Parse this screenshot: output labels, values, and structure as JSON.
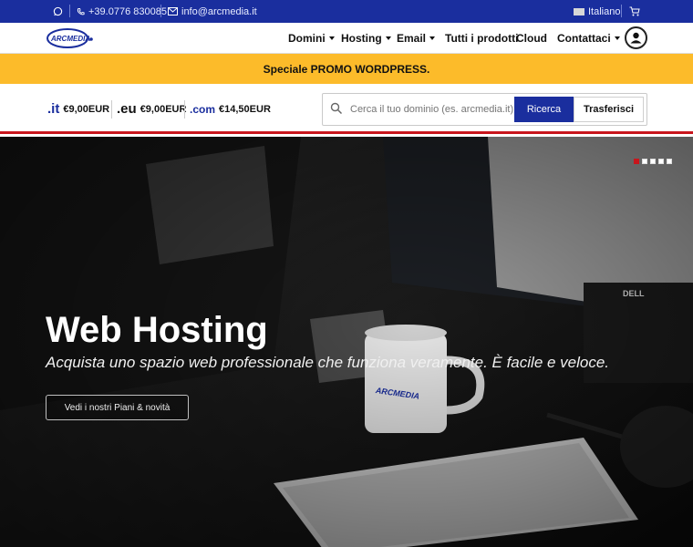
{
  "topbar": {
    "phone": "+39.0776 830085",
    "email": "info@arcmedia.it",
    "language": "Italiano",
    "icons": [
      "whatsapp-icon",
      "phone-icon",
      "mail-icon",
      "flag-icon",
      "cart-icon"
    ]
  },
  "nav": {
    "logo_text": "ARCMEDIA",
    "items": [
      {
        "label": "Domini",
        "dropdown": true
      },
      {
        "label": "Hosting",
        "dropdown": true
      },
      {
        "label": "Email",
        "dropdown": true
      },
      {
        "label": "Tutti i prodotti",
        "dropdown": false
      },
      {
        "label": "Cloud",
        "dropdown": false
      },
      {
        "label": "Contattaci",
        "dropdown": true
      }
    ]
  },
  "promo": {
    "text": "Speciale PROMO WORDPRESS."
  },
  "domains": {
    "tlds": [
      {
        "mark": ".it",
        "price": "€9,00EUR"
      },
      {
        "mark": ".eu",
        "price": "€9,00EUR"
      },
      {
        "mark": ".com",
        "price": "€14,50EUR"
      }
    ],
    "search_placeholder": "Cerca il tuo dominio (es. arcmedia.it)",
    "search_button": "Ricerca",
    "transfer_button": "Trasferisci"
  },
  "hero": {
    "title": "Web Hosting",
    "subtitle": "Acquista uno spazio web professionale che funziona veramente. È facile e veloce.",
    "cta": "Vedi i nostri Piani & novità",
    "slides": 5,
    "active_slide": 1
  },
  "colors": {
    "topbar": "#1a2e9e",
    "promo": "#fcbb2a",
    "accent_red": "#c8161d",
    "button_blue": "#1a2e9e"
  }
}
